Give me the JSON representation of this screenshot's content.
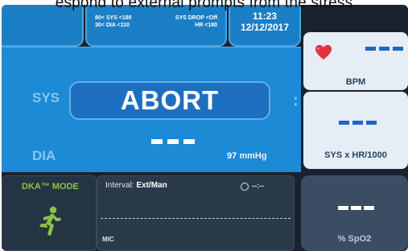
{
  "caption": "espond to external prompts from the stress",
  "header": {
    "limits_row1_left": "80< SYS <180",
    "limits_row1_right": "SYS DROP <Off",
    "limits_row2_left": "30< DIA <110",
    "limits_row2_right": "HR <180",
    "time": "11:23",
    "date": "12/12/2017"
  },
  "main": {
    "sys_label": "SYS",
    "dia_label": "DIA",
    "abort_label": "ABORT",
    "pressure_value": "97",
    "pressure_unit": "mmHg",
    "colon": ":"
  },
  "right": {
    "bpm_label": "BPM",
    "sys_hr_label": "SYS x HR/1000",
    "spo2_label": "% SpO2"
  },
  "bottom": {
    "dka_title": "DKA™ MODE",
    "interval_key": "Interval:",
    "interval_value": "Ext/Man",
    "timer": "--:--",
    "mic": "MIC"
  },
  "colors": {
    "main_blue": "#1d8ad6",
    "accent_green": "#8bc43f",
    "heart_red": "#e2343f",
    "dash_blue": "#1e66c8"
  },
  "icons": [
    "heart-icon",
    "runner-icon",
    "clock-icon"
  ]
}
